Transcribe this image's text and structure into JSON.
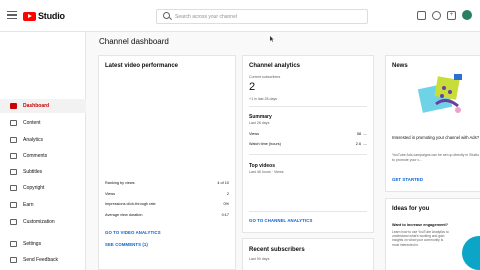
{
  "header": {
    "logo_text": "Studio",
    "search_placeholder": "Search across your channel",
    "icons": [
      "hamburger-icon",
      "messages-icon",
      "help-icon",
      "create-icon",
      "avatar"
    ],
    "create_glyph": "+"
  },
  "sidebar": {
    "items": [
      {
        "label": "Dashboard",
        "active": true
      },
      {
        "label": "Content"
      },
      {
        "label": "Analytics"
      },
      {
        "label": "Comments"
      },
      {
        "label": "Subtitles"
      },
      {
        "label": "Copyright"
      },
      {
        "label": "Earn"
      },
      {
        "label": "Customization"
      },
      {
        "label": "Settings"
      },
      {
        "label": "Send Feedback"
      }
    ]
  },
  "main": {
    "title": "Channel dashboard",
    "latest_video": {
      "title": "Latest video performance",
      "stats": [
        {
          "label": "Ranking by views",
          "value": "4 of 10"
        },
        {
          "label": "Views",
          "value": "2"
        },
        {
          "label": "Impressions click-through rate",
          "value": "0%"
        },
        {
          "label": "Average view duration",
          "value": "0:17"
        }
      ],
      "link_analytics": "GO TO VIDEO ANALYTICS",
      "link_comments": "SEE COMMENTS (1)"
    },
    "channel_analytics": {
      "title": "Channel analytics",
      "subs_label": "Current subscribers",
      "subs_value": "2",
      "subs_change": "+1 in last 28 days",
      "summary_title": "Summary",
      "summary_period": "Last 28 days",
      "rows": [
        {
          "label": "Views",
          "value": "58",
          "trend": "—"
        },
        {
          "label": "Watch time (hours)",
          "value": "2.6",
          "trend": "—"
        }
      ],
      "top_videos_title": "Top videos",
      "top_videos_period": "Last 48 hours · Views",
      "link": "GO TO CHANNEL ANALYTICS"
    },
    "recent_subscribers": {
      "title": "Recent subscribers",
      "period": "Last 90 days"
    },
    "news": {
      "title": "News",
      "headline": "Interested in promoting your channel with Ads?",
      "body": "YouTube Ads campaigns can be set up directly in Studio to promote your c...",
      "link": "GET STARTED"
    },
    "ideas": {
      "title": "Ideas for you",
      "subtitle": "Want to increase engagement?",
      "body": "Learn how to use YouTube Analytics to understand what's working and gain insights on what your community is most interested in."
    }
  },
  "colors": {
    "accent_red": "#cc0000",
    "link_blue": "#065fd4",
    "logo_red": "#ff0000"
  }
}
